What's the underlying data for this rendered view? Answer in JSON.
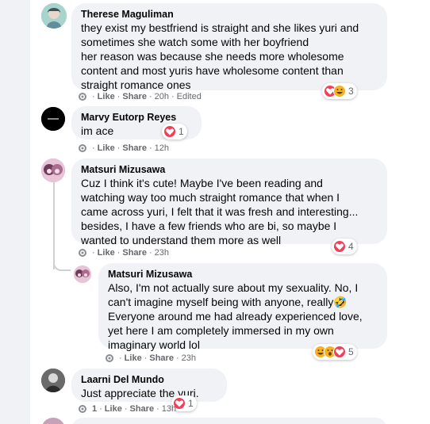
{
  "comments": [
    {
      "author": "Therese Maguliman",
      "text": "they exist my bestfriend is straight and she likes yuri and\nsometimes she watch some with her boyfriend\nher reason was because she needs more wholesome\ncontent and most yuris have wholesome content than\nstraight romance ones",
      "like": "Like",
      "share": "Share",
      "time": "20h",
      "edited": "Edited",
      "reaction_count": "3",
      "reactions": [
        "love",
        "haha"
      ]
    },
    {
      "author": "Marvy Eutorp Reyes",
      "text": "im ace",
      "like": "Like",
      "share": "Share",
      "time": "12h",
      "reaction_count": "1",
      "reactions": [
        "love"
      ]
    },
    {
      "author": "Matsuri Mizusawa",
      "text": "Cuz I think it's cute! Maybe I've been reading and\nwatching way too much straight romance that when I\ncame across yuri, I felt that it was fresh and interesting...\nbesides, I have a few friends who are bi, so maybe I\nwanted to understand them more as well",
      "like": "Like",
      "share": "Share",
      "time": "23h",
      "reaction_count": "4",
      "reactions": [
        "love"
      ]
    },
    {
      "author": "Matsuri Mizusawa",
      "text": "Also, I'm not actually sure about my sexuality. No, I\ncan't imagine myself being with anyone, really🤣\nEveryone around me had already experienced love,\nyet here I am completely immersed in my own\nimaginary world lol",
      "like": "Like",
      "share": "Share",
      "time": "23h",
      "reaction_count": "5",
      "reactions": [
        "haha",
        "wow",
        "love"
      ]
    },
    {
      "author": "Laarni Del Mundo",
      "text": "Just appreciate the yuri.",
      "reply_count": "1",
      "like": "Like",
      "share": "Share",
      "time": "13h",
      "reaction_count": "1",
      "reactions": [
        "love"
      ]
    }
  ],
  "colors": {
    "love": "#f33e58",
    "haha": "#f7b125",
    "wow": "#f7b125",
    "bubble": "#f0f2f5",
    "meta": "#65676b"
  }
}
